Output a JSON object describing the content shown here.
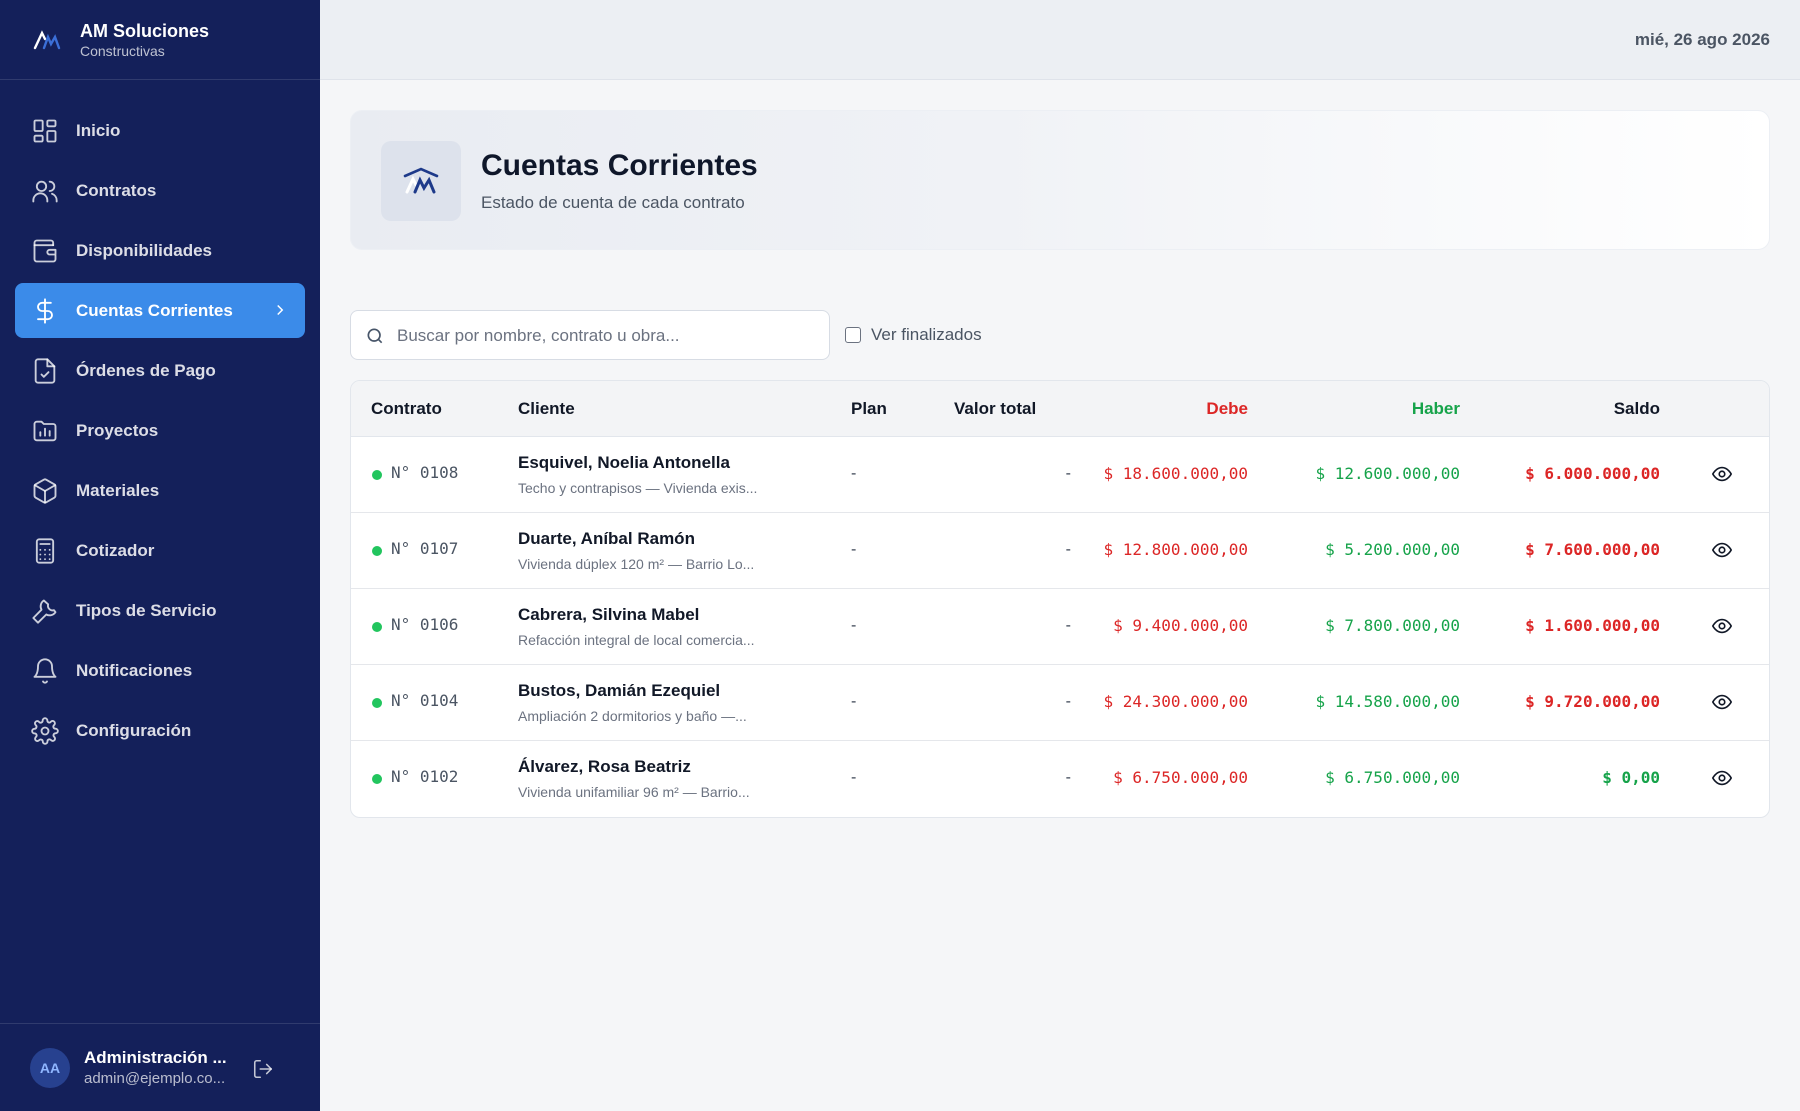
{
  "brand": {
    "title": "AM Soluciones",
    "subtitle": "Constructivas"
  },
  "header": {
    "date": "mié, 26 ago 2026"
  },
  "nav": [
    {
      "label": "Inicio",
      "icon": "grid-icon"
    },
    {
      "label": "Contratos",
      "icon": "users-icon"
    },
    {
      "label": "Disponibilidades",
      "icon": "wallet-icon"
    },
    {
      "label": "Cuentas Corrientes",
      "icon": "dollar-icon",
      "active": true
    },
    {
      "label": "Órdenes de Pago",
      "icon": "file-check-icon"
    },
    {
      "label": "Proyectos",
      "icon": "folder-chart-icon"
    },
    {
      "label": "Materiales",
      "icon": "box-icon"
    },
    {
      "label": "Cotizador",
      "icon": "calculator-icon"
    },
    {
      "label": "Tipos de Servicio",
      "icon": "wrench-icon"
    },
    {
      "label": "Notificaciones",
      "icon": "bell-icon"
    },
    {
      "label": "Configuración",
      "icon": "gear-icon"
    }
  ],
  "user": {
    "initials": "AA",
    "name": "Administración ...",
    "email": "admin@ejemplo.co..."
  },
  "page": {
    "title": "Cuentas Corrientes",
    "subtitle": "Estado de cuenta de cada contrato"
  },
  "filters": {
    "search_placeholder": "Buscar por nombre, contrato u obra...",
    "show_finished_label": "Ver finalizados",
    "show_finished_checked": false
  },
  "table": {
    "columns": [
      "Contrato",
      "Cliente",
      "Plan",
      "Valor total",
      "Debe",
      "Haber",
      "Saldo"
    ],
    "rows": [
      {
        "contract": "N° 0108",
        "client": "Esquivel, Noelia Antonella",
        "desc": "Techo y contrapisos — Vivienda exis...",
        "plan": "-",
        "total": "-",
        "debe": "$ 18.600.000,00",
        "haber": "$ 12.600.000,00",
        "saldo": "$ 6.000.000,00",
        "saldo_positive": true
      },
      {
        "contract": "N° 0107",
        "client": "Duarte, Aníbal Ramón",
        "desc": "Vivienda dúplex 120 m² — Barrio Lo...",
        "plan": "-",
        "total": "-",
        "debe": "$ 12.800.000,00",
        "haber": "$ 5.200.000,00",
        "saldo": "$ 7.600.000,00",
        "saldo_positive": true
      },
      {
        "contract": "N° 0106",
        "client": "Cabrera, Silvina Mabel",
        "desc": "Refacción integral de local comercia...",
        "plan": "-",
        "total": "-",
        "debe": "$ 9.400.000,00",
        "haber": "$ 7.800.000,00",
        "saldo": "$ 1.600.000,00",
        "saldo_positive": true
      },
      {
        "contract": "N° 0104",
        "client": "Bustos, Damián Ezequiel",
        "desc": "Ampliación 2 dormitorios y baño —...",
        "plan": "-",
        "total": "-",
        "debe": "$ 24.300.000,00",
        "haber": "$ 14.580.000,00",
        "saldo": "$ 9.720.000,00",
        "saldo_positive": true
      },
      {
        "contract": "N° 0102",
        "client": "Álvarez, Rosa Beatriz",
        "desc": "Vivienda unifamiliar 96 m² — Barrio...",
        "plan": "-",
        "total": "-",
        "debe": "$ 6.750.000,00",
        "haber": "$ 6.750.000,00",
        "saldo": "$ 0,00",
        "saldo_positive": false
      }
    ]
  },
  "colors": {
    "sidebar": "#14205a",
    "active": "#3b8be9",
    "debe": "#dc2626",
    "haber": "#16a34a",
    "status_active": "#22c55e"
  }
}
